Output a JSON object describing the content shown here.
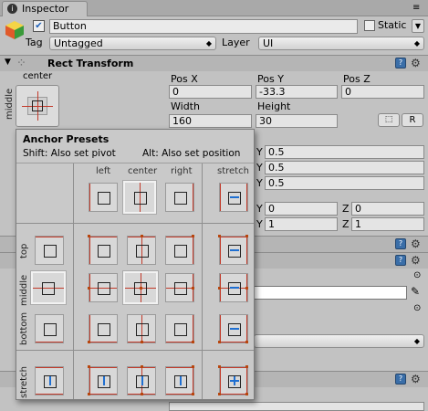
{
  "tab": {
    "title": "Inspector"
  },
  "object": {
    "name": "Button",
    "static_label": "Static",
    "tag_label": "Tag",
    "tag_value": "Untagged",
    "layer_label": "Layer",
    "layer_value": "UI"
  },
  "rect": {
    "title": "Rect Transform",
    "anchor_h": "center",
    "anchor_v": "middle",
    "posx_label": "Pos X",
    "posy_label": "Pos Y",
    "posz_label": "Pos Z",
    "posx": "0",
    "posy": "-33.3",
    "posz": "0",
    "width_label": "Width",
    "height_label": "Height",
    "width": "160",
    "height": "30",
    "r_button": "R",
    "y1_label": "Y",
    "y1": "0.5",
    "y2_label": "Y",
    "y2": "0.5",
    "y3_label": "Y",
    "y3": "0.5",
    "rot_y_label": "Y",
    "rot_y": "0",
    "rot_z_label": "Z",
    "rot_z": "0",
    "scale_y_label": "Y",
    "scale_y": "1",
    "scale_z_label": "Z",
    "scale_z": "1"
  },
  "presets": {
    "title": "Anchor Presets",
    "shift_hint": "Shift: Also set pivot",
    "alt_hint": "Alt: Also set position",
    "cols": [
      "left",
      "center",
      "right",
      "stretch"
    ],
    "rows": [
      "top",
      "middle",
      "bottom",
      "stretch"
    ]
  },
  "colors": {
    "panel_bg": "#c2c2c2",
    "popup_bg": "#c9c9c9",
    "anchor_red": "#c23a2a",
    "stretch_blue": "#1f6fd1"
  }
}
